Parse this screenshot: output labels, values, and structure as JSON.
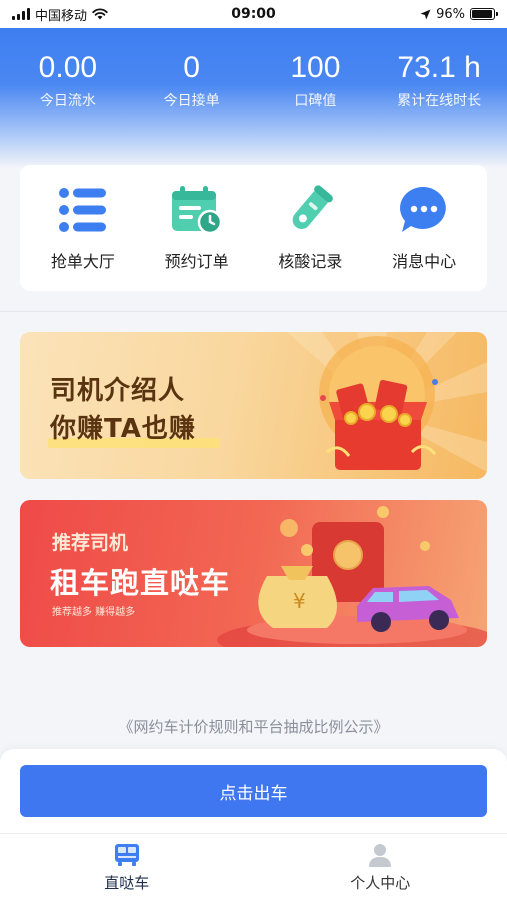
{
  "status_bar": {
    "carrier": "中国移动",
    "time": "09:00",
    "battery": "96%",
    "battery_level": 0.96
  },
  "stats": [
    {
      "value": "0.00",
      "label": "今日流水"
    },
    {
      "value": "0",
      "label": "今日接单"
    },
    {
      "value": "100",
      "label": "口碑值"
    },
    {
      "value": "73.1 h",
      "label": "累计在线时长"
    }
  ],
  "menu": [
    {
      "label": "抢单大厅",
      "icon": "list-icon"
    },
    {
      "label": "预约订单",
      "icon": "calendar-clock-icon"
    },
    {
      "label": "核酸记录",
      "icon": "test-tube-icon"
    },
    {
      "label": "消息中心",
      "icon": "chat-bubble-icon"
    }
  ],
  "banners": {
    "referral": {
      "line1": "司机介绍人",
      "line2": "你赚TA也赚"
    },
    "rental": {
      "tag": "推荐司机",
      "title": "租车跑直哒车",
      "subtitle": "推荐越多 赚得越多"
    }
  },
  "rules_link": "《网约车计价规则和平台抽成比例公示》",
  "depart_button": "点击出车",
  "tabs": [
    {
      "label": "直哒车",
      "icon": "bus-icon",
      "active": true
    },
    {
      "label": "个人中心",
      "icon": "person-icon",
      "active": false
    }
  ],
  "colors": {
    "primary": "#3f77f0",
    "menu_blue": "#3d7ef0",
    "menu_teal": "#4fcfb0"
  }
}
